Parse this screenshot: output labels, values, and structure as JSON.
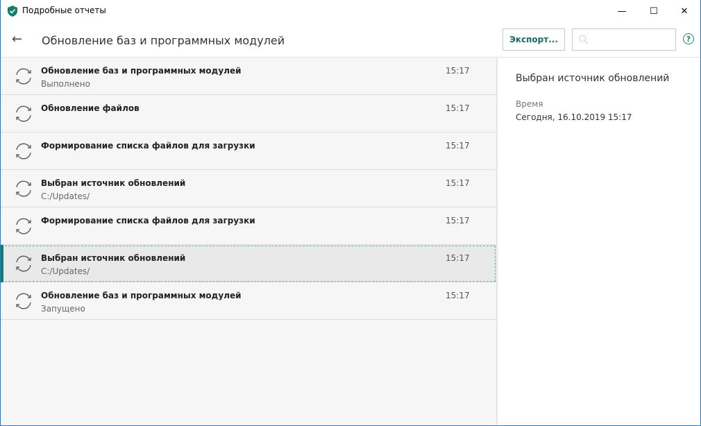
{
  "window": {
    "title": "Подробные отчеты",
    "minimize": "—",
    "maximize": "☐",
    "close": "✕"
  },
  "header": {
    "back": "←",
    "title": "Обновление баз и программных модулей",
    "export_label": "Экспорт...",
    "search_placeholder": "",
    "help": "?"
  },
  "events": [
    {
      "title": "Обновление баз и программных модулей",
      "subtitle": "Выполнено",
      "time": "15:17"
    },
    {
      "title": "Обновление файлов",
      "subtitle": "",
      "time": "15:17"
    },
    {
      "title": "Формирование списка файлов для загрузки",
      "subtitle": "",
      "time": "15:17"
    },
    {
      "title": "Выбран источник обновлений",
      "subtitle": "C:/Updates/",
      "time": "15:17"
    },
    {
      "title": "Формирование списка файлов для загрузки",
      "subtitle": "",
      "time": "15:17"
    },
    {
      "title": "Выбран источник обновлений",
      "subtitle": "C:/Updates/",
      "time": "15:17",
      "selected": true
    },
    {
      "title": "Обновление баз и программных модулей",
      "subtitle": "Запущено",
      "time": "15:17"
    }
  ],
  "detail": {
    "title": "Выбран источник обновлений",
    "time_label": "Время",
    "time_value": "Сегодня, 16.10.2019 15:17"
  },
  "colors": {
    "accent": "#11806a",
    "window_border": "#1a7ad9"
  }
}
